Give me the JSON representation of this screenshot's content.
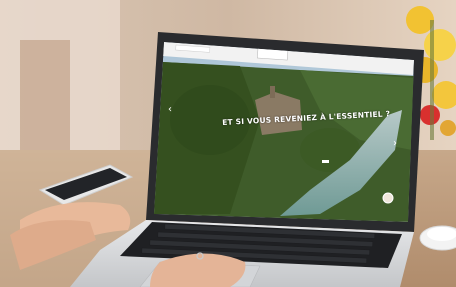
{
  "photo": {
    "hero_headline": "ET SI VOUS REVENIEZ À L'ESSENTIEL ?"
  }
}
